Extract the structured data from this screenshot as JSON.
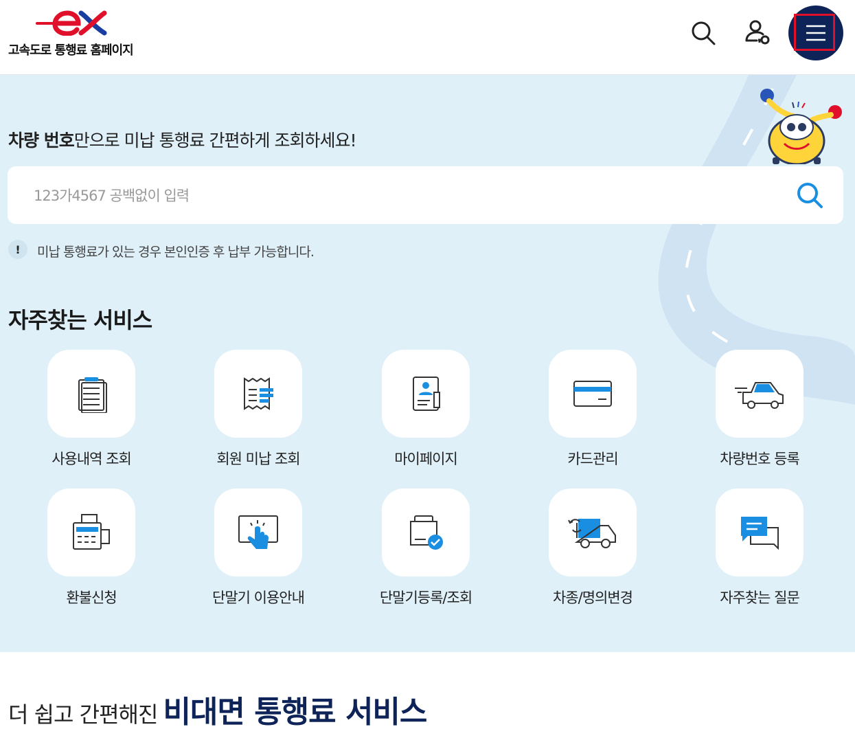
{
  "header": {
    "site_name": "고속도로 통행료 홈페이지",
    "icons": {
      "search": "search-icon",
      "user": "user-key-icon",
      "menu": "hamburger-menu-icon"
    }
  },
  "hero": {
    "headline_bold": "차량 번호",
    "headline_rest": "만으로 미납 통행료 간편하게 조회하세요!",
    "search_placeholder": "123가4567 공백없이 입력",
    "search_value": "",
    "notice": "미납 통행료가 있는 경우 본인인증 후 납부 가능합니다.",
    "notice_icon": "!"
  },
  "services": {
    "title": "자주찾는 서비스",
    "items": [
      {
        "label": "사용내역 조회",
        "icon": "clipboard-list-icon"
      },
      {
        "label": "회원 미납 조회",
        "icon": "receipt-icon"
      },
      {
        "label": "마이페이지",
        "icon": "profile-card-icon"
      },
      {
        "label": "카드관리",
        "icon": "credit-card-icon"
      },
      {
        "label": "차량번호 등록",
        "icon": "car-icon"
      },
      {
        "label": "환불신청",
        "icon": "fax-refund-icon"
      },
      {
        "label": "단말기 이용안내",
        "icon": "touch-screen-icon"
      },
      {
        "label": "단말기등록/조회",
        "icon": "device-check-icon"
      },
      {
        "label": "차종/명의변경",
        "icon": "truck-change-icon"
      },
      {
        "label": "자주찾는 질문",
        "icon": "chat-bubbles-icon"
      }
    ]
  },
  "bottom": {
    "lead": "더 쉽고 간편해진",
    "strong": "비대면 통행료 서비스"
  },
  "colors": {
    "brand_navy": "#0e2458",
    "brand_red": "#e0102a",
    "accent_blue": "#1a8ee0",
    "band_bg": "#dff0f8"
  }
}
